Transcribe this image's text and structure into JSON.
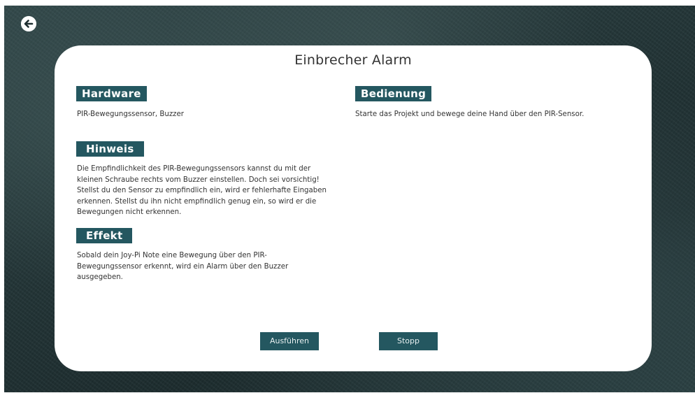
{
  "navigation": {
    "back_icon": "arrow-left-circle-icon"
  },
  "project": {
    "title": "Einbrecher Alarm"
  },
  "sections": {
    "hardware": {
      "heading": "Hardware",
      "text": "PIR-Bewegungssensor, Buzzer"
    },
    "hinweis": {
      "heading": "Hinweis",
      "line1": "Die Empfindlichkeit des PIR-Bewegungssensors kannst du mit der",
      "line2": "kleinen Schraube rechts vom Buzzer einstellen. Doch sei vorsichtig!",
      "line3": "Stellst du den Sensor zu empfindlich ein, wird er fehlerhafte Eingaben",
      "line4": "erkennen. Stellst du ihn nicht empfindlich genug ein, so wird er die",
      "line5": "Bewegungen nicht erkennen."
    },
    "effekt": {
      "heading": "Effekt",
      "line1": "Sobald dein Joy-Pi Note eine Bewegung über den PIR-",
      "line2": "Bewegungssensor erkennt, wird ein Alarm über den Buzzer",
      "line3": "ausgegeben."
    },
    "bedienung": {
      "heading": "Bedienung",
      "text": "Starte das Projekt und bewege deine Hand über den PIR-Sensor."
    }
  },
  "actions": {
    "run_label": "Ausführen",
    "stop_label": "Stopp"
  },
  "colors": {
    "accent": "#245760",
    "card_background": "#ffffff",
    "page_background": "#223436",
    "text": "#333333"
  }
}
